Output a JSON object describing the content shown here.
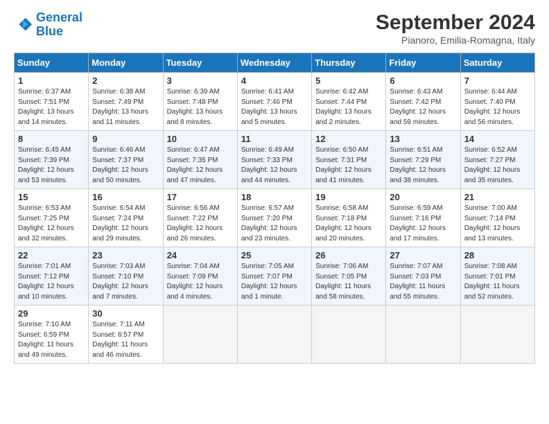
{
  "header": {
    "logo_line1": "General",
    "logo_line2": "Blue",
    "month": "September 2024",
    "location": "Pianoro, Emilia-Romagna, Italy"
  },
  "days_of_week": [
    "Sunday",
    "Monday",
    "Tuesday",
    "Wednesday",
    "Thursday",
    "Friday",
    "Saturday"
  ],
  "weeks": [
    [
      {
        "day": "1",
        "sunrise": "Sunrise: 6:37 AM",
        "sunset": "Sunset: 7:51 PM",
        "daylight": "Daylight: 13 hours and 14 minutes."
      },
      {
        "day": "2",
        "sunrise": "Sunrise: 6:38 AM",
        "sunset": "Sunset: 7:49 PM",
        "daylight": "Daylight: 13 hours and 11 minutes."
      },
      {
        "day": "3",
        "sunrise": "Sunrise: 6:39 AM",
        "sunset": "Sunset: 7:48 PM",
        "daylight": "Daylight: 13 hours and 8 minutes."
      },
      {
        "day": "4",
        "sunrise": "Sunrise: 6:41 AM",
        "sunset": "Sunset: 7:46 PM",
        "daylight": "Daylight: 13 hours and 5 minutes."
      },
      {
        "day": "5",
        "sunrise": "Sunrise: 6:42 AM",
        "sunset": "Sunset: 7:44 PM",
        "daylight": "Daylight: 13 hours and 2 minutes."
      },
      {
        "day": "6",
        "sunrise": "Sunrise: 6:43 AM",
        "sunset": "Sunset: 7:42 PM",
        "daylight": "Daylight: 12 hours and 59 minutes."
      },
      {
        "day": "7",
        "sunrise": "Sunrise: 6:44 AM",
        "sunset": "Sunset: 7:40 PM",
        "daylight": "Daylight: 12 hours and 56 minutes."
      }
    ],
    [
      {
        "day": "8",
        "sunrise": "Sunrise: 6:45 AM",
        "sunset": "Sunset: 7:39 PM",
        "daylight": "Daylight: 12 hours and 53 minutes."
      },
      {
        "day": "9",
        "sunrise": "Sunrise: 6:46 AM",
        "sunset": "Sunset: 7:37 PM",
        "daylight": "Daylight: 12 hours and 50 minutes."
      },
      {
        "day": "10",
        "sunrise": "Sunrise: 6:47 AM",
        "sunset": "Sunset: 7:35 PM",
        "daylight": "Daylight: 12 hours and 47 minutes."
      },
      {
        "day": "11",
        "sunrise": "Sunrise: 6:49 AM",
        "sunset": "Sunset: 7:33 PM",
        "daylight": "Daylight: 12 hours and 44 minutes."
      },
      {
        "day": "12",
        "sunrise": "Sunrise: 6:50 AM",
        "sunset": "Sunset: 7:31 PM",
        "daylight": "Daylight: 12 hours and 41 minutes."
      },
      {
        "day": "13",
        "sunrise": "Sunrise: 6:51 AM",
        "sunset": "Sunset: 7:29 PM",
        "daylight": "Daylight: 12 hours and 38 minutes."
      },
      {
        "day": "14",
        "sunrise": "Sunrise: 6:52 AM",
        "sunset": "Sunset: 7:27 PM",
        "daylight": "Daylight: 12 hours and 35 minutes."
      }
    ],
    [
      {
        "day": "15",
        "sunrise": "Sunrise: 6:53 AM",
        "sunset": "Sunset: 7:25 PM",
        "daylight": "Daylight: 12 hours and 32 minutes."
      },
      {
        "day": "16",
        "sunrise": "Sunrise: 6:54 AM",
        "sunset": "Sunset: 7:24 PM",
        "daylight": "Daylight: 12 hours and 29 minutes."
      },
      {
        "day": "17",
        "sunrise": "Sunrise: 6:56 AM",
        "sunset": "Sunset: 7:22 PM",
        "daylight": "Daylight: 12 hours and 26 minutes."
      },
      {
        "day": "18",
        "sunrise": "Sunrise: 6:57 AM",
        "sunset": "Sunset: 7:20 PM",
        "daylight": "Daylight: 12 hours and 23 minutes."
      },
      {
        "day": "19",
        "sunrise": "Sunrise: 6:58 AM",
        "sunset": "Sunset: 7:18 PM",
        "daylight": "Daylight: 12 hours and 20 minutes."
      },
      {
        "day": "20",
        "sunrise": "Sunrise: 6:59 AM",
        "sunset": "Sunset: 7:16 PM",
        "daylight": "Daylight: 12 hours and 17 minutes."
      },
      {
        "day": "21",
        "sunrise": "Sunrise: 7:00 AM",
        "sunset": "Sunset: 7:14 PM",
        "daylight": "Daylight: 12 hours and 13 minutes."
      }
    ],
    [
      {
        "day": "22",
        "sunrise": "Sunrise: 7:01 AM",
        "sunset": "Sunset: 7:12 PM",
        "daylight": "Daylight: 12 hours and 10 minutes."
      },
      {
        "day": "23",
        "sunrise": "Sunrise: 7:03 AM",
        "sunset": "Sunset: 7:10 PM",
        "daylight": "Daylight: 12 hours and 7 minutes."
      },
      {
        "day": "24",
        "sunrise": "Sunrise: 7:04 AM",
        "sunset": "Sunset: 7:09 PM",
        "daylight": "Daylight: 12 hours and 4 minutes."
      },
      {
        "day": "25",
        "sunrise": "Sunrise: 7:05 AM",
        "sunset": "Sunset: 7:07 PM",
        "daylight": "Daylight: 12 hours and 1 minute."
      },
      {
        "day": "26",
        "sunrise": "Sunrise: 7:06 AM",
        "sunset": "Sunset: 7:05 PM",
        "daylight": "Daylight: 11 hours and 58 minutes."
      },
      {
        "day": "27",
        "sunrise": "Sunrise: 7:07 AM",
        "sunset": "Sunset: 7:03 PM",
        "daylight": "Daylight: 11 hours and 55 minutes."
      },
      {
        "day": "28",
        "sunrise": "Sunrise: 7:08 AM",
        "sunset": "Sunset: 7:01 PM",
        "daylight": "Daylight: 11 hours and 52 minutes."
      }
    ],
    [
      {
        "day": "29",
        "sunrise": "Sunrise: 7:10 AM",
        "sunset": "Sunset: 6:59 PM",
        "daylight": "Daylight: 11 hours and 49 minutes."
      },
      {
        "day": "30",
        "sunrise": "Sunrise: 7:11 AM",
        "sunset": "Sunset: 6:57 PM",
        "daylight": "Daylight: 11 hours and 46 minutes."
      },
      null,
      null,
      null,
      null,
      null
    ]
  ]
}
